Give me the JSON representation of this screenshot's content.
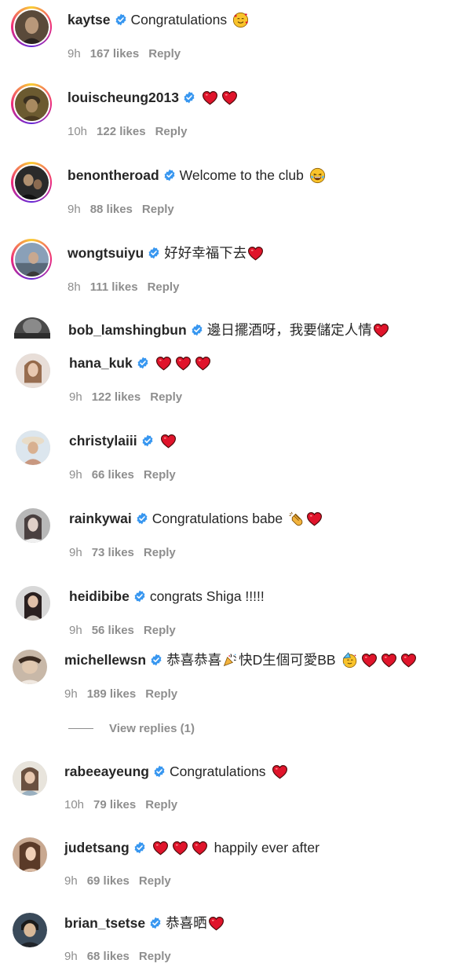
{
  "colors": {
    "verified": "#3897f0",
    "heart": "#e0142b",
    "muted": "#8e8e8e",
    "text": "#262626"
  },
  "comments": [
    {
      "username": "kaytse",
      "text": "Congratulations",
      "emojis": [
        "smiling-hearts-emoji"
      ],
      "time": "9h",
      "likes": "167 likes",
      "reply": "Reply",
      "avatar_ring": true
    },
    {
      "username": "louischeung2013",
      "text": "",
      "emojis": [
        "red-heart-emoji",
        "red-heart-emoji"
      ],
      "time": "10h",
      "likes": "122 likes",
      "reply": "Reply",
      "avatar_ring": true
    },
    {
      "username": "benontheroad",
      "text": "Welcome to the club",
      "emojis": [
        "tears-of-joy-emoji"
      ],
      "time": "9h",
      "likes": "88 likes",
      "reply": "Reply",
      "avatar_ring": true
    },
    {
      "username": "wongtsuiyu",
      "text": "好好幸福下去",
      "emojis": [
        "red-heart-emoji"
      ],
      "time": "8h",
      "likes": "111 likes",
      "reply": "Reply",
      "avatar_ring": true
    },
    {
      "username": "bob_lamshingbun",
      "text": "邊日擺酒呀，我要儲定人情",
      "emojis": [
        "red-heart-emoji"
      ],
      "time": "",
      "likes": "",
      "reply": "",
      "avatar_ring": false
    },
    {
      "username": "hana_kuk",
      "text": "",
      "emojis": [
        "red-heart-emoji",
        "red-heart-emoji",
        "red-heart-emoji"
      ],
      "time": "9h",
      "likes": "122 likes",
      "reply": "Reply",
      "avatar_ring": false
    },
    {
      "username": "christylaiii",
      "text": "",
      "emojis": [
        "red-heart-emoji"
      ],
      "time": "9h",
      "likes": "66 likes",
      "reply": "Reply",
      "avatar_ring": false
    },
    {
      "username": "rainkywai",
      "text": "Congratulations babe",
      "emojis": [
        "clapping-hands-emoji",
        "red-heart-emoji"
      ],
      "time": "9h",
      "likes": "73 likes",
      "reply": "Reply",
      "avatar_ring": false
    },
    {
      "username": "heidibibe",
      "text": "congrats Shiga !!!!!",
      "emojis": [],
      "time": "9h",
      "likes": "56 likes",
      "reply": "Reply",
      "avatar_ring": false
    },
    {
      "username": "michellewsn",
      "text_before": "恭喜恭喜",
      "text_after": "快D生個可愛BB",
      "emojis": [
        "party-face-emoji",
        "red-heart-emoji",
        "red-heart-emoji",
        "red-heart-emoji"
      ],
      "time": "9h",
      "likes": "189 likes",
      "reply": "Reply",
      "avatar_ring": false,
      "view_replies": "View replies (1)"
    },
    {
      "username": "rabeeayeung",
      "text": "Congratulations",
      "emojis": [
        "red-heart-emoji"
      ],
      "time": "10h",
      "likes": "79 likes",
      "reply": "Reply",
      "avatar_ring": false
    },
    {
      "username": "judetsang",
      "text": "happily ever after",
      "emojis_before": [
        "red-heart-emoji",
        "red-heart-emoji",
        "red-heart-emoji"
      ],
      "emojis": [],
      "time": "9h",
      "likes": "69 likes",
      "reply": "Reply",
      "avatar_ring": false
    },
    {
      "username": "brian_tsetse",
      "text": "恭喜晒",
      "emojis": [
        "red-heart-emoji"
      ],
      "time": "9h",
      "likes": "68 likes",
      "reply": "Reply",
      "avatar_ring": false
    }
  ]
}
